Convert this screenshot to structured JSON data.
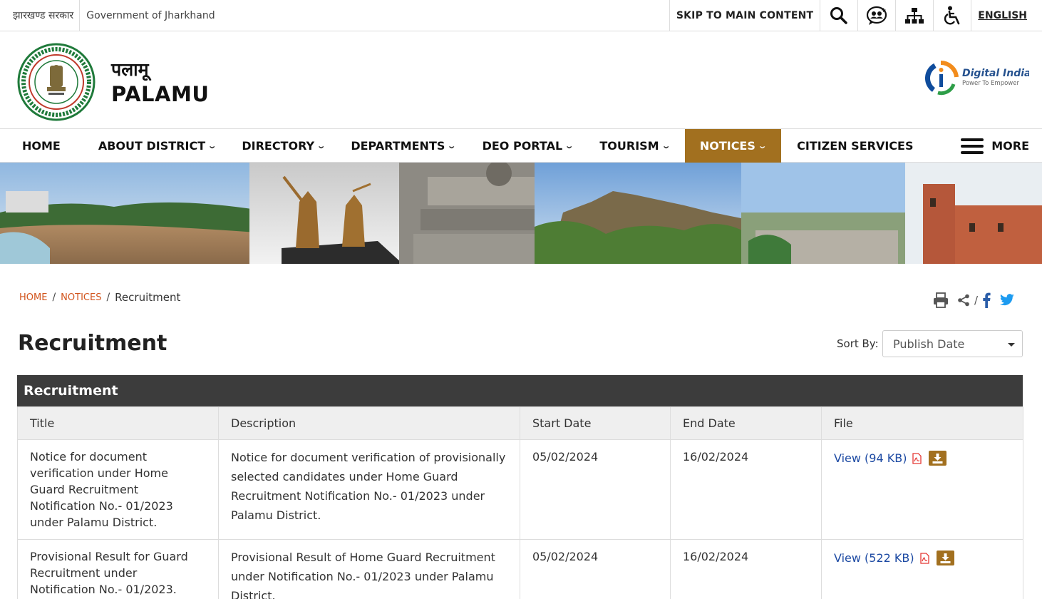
{
  "topbar": {
    "gov_hi": "झारखण्ड सरकार",
    "gov_en": "Government of Jharkhand",
    "skip": "SKIP TO MAIN CONTENT",
    "icons": [
      "search-icon",
      "social-media-icon",
      "sitemap-icon",
      "accessibility-icon"
    ],
    "language": "ENGLISH"
  },
  "header": {
    "title_hi": "पलामू",
    "title_en": "PALAMU",
    "emblem_text": "झारखण्ड सरकार GOVERNMENT OF JHARKHAND",
    "digital_india": "Digital India",
    "digital_india_tag": "Power To Empower"
  },
  "nav": {
    "items": [
      {
        "label": "HOME",
        "dropdown": false
      },
      {
        "label": "ABOUT DISTRICT",
        "dropdown": true
      },
      {
        "label": "DIRECTORY",
        "dropdown": true
      },
      {
        "label": "DEPARTMENTS",
        "dropdown": true
      },
      {
        "label": "DEO PORTAL",
        "dropdown": true
      },
      {
        "label": "TOURISM",
        "dropdown": true
      },
      {
        "label": "NOTICES",
        "dropdown": true,
        "active": true
      },
      {
        "label": "CITIZEN SERVICES",
        "dropdown": false
      }
    ],
    "more": "MORE",
    "chevron": "⌄",
    "active_color": "#a2701f"
  },
  "breadcrumb": {
    "home": "HOME",
    "notices": "NOTICES",
    "separator": "/",
    "current": "Recruitment"
  },
  "share": {
    "separator": "/"
  },
  "page": {
    "title": "Recruitment",
    "sort_label": "Sort By:",
    "sort_value": "Publish Date"
  },
  "table": {
    "caption": "Recruitment",
    "headers": [
      "Title",
      "Description",
      "Start Date",
      "End Date",
      "File"
    ],
    "rows": [
      {
        "title": "Notice for document verification under Home Guard Recruitment Notification No.- 01/2023 under Palamu District.",
        "description": "Notice for document verification of provisionally selected candidates under Home Guard Recruitment Notification No.- 01/2023 under Palamu District.",
        "start": "05/02/2024",
        "end": "16/02/2024",
        "file": "View (94 KB)"
      },
      {
        "title": "Provisional Result for Guard Recruitment under Notification No.- 01/2023.",
        "description": "Provisional Result of Home Guard Recruitment under Notification No.- 01/2023 under Palamu District.",
        "start": "05/02/2024",
        "end": "16/02/2024",
        "file": "View (522 KB)"
      }
    ]
  }
}
